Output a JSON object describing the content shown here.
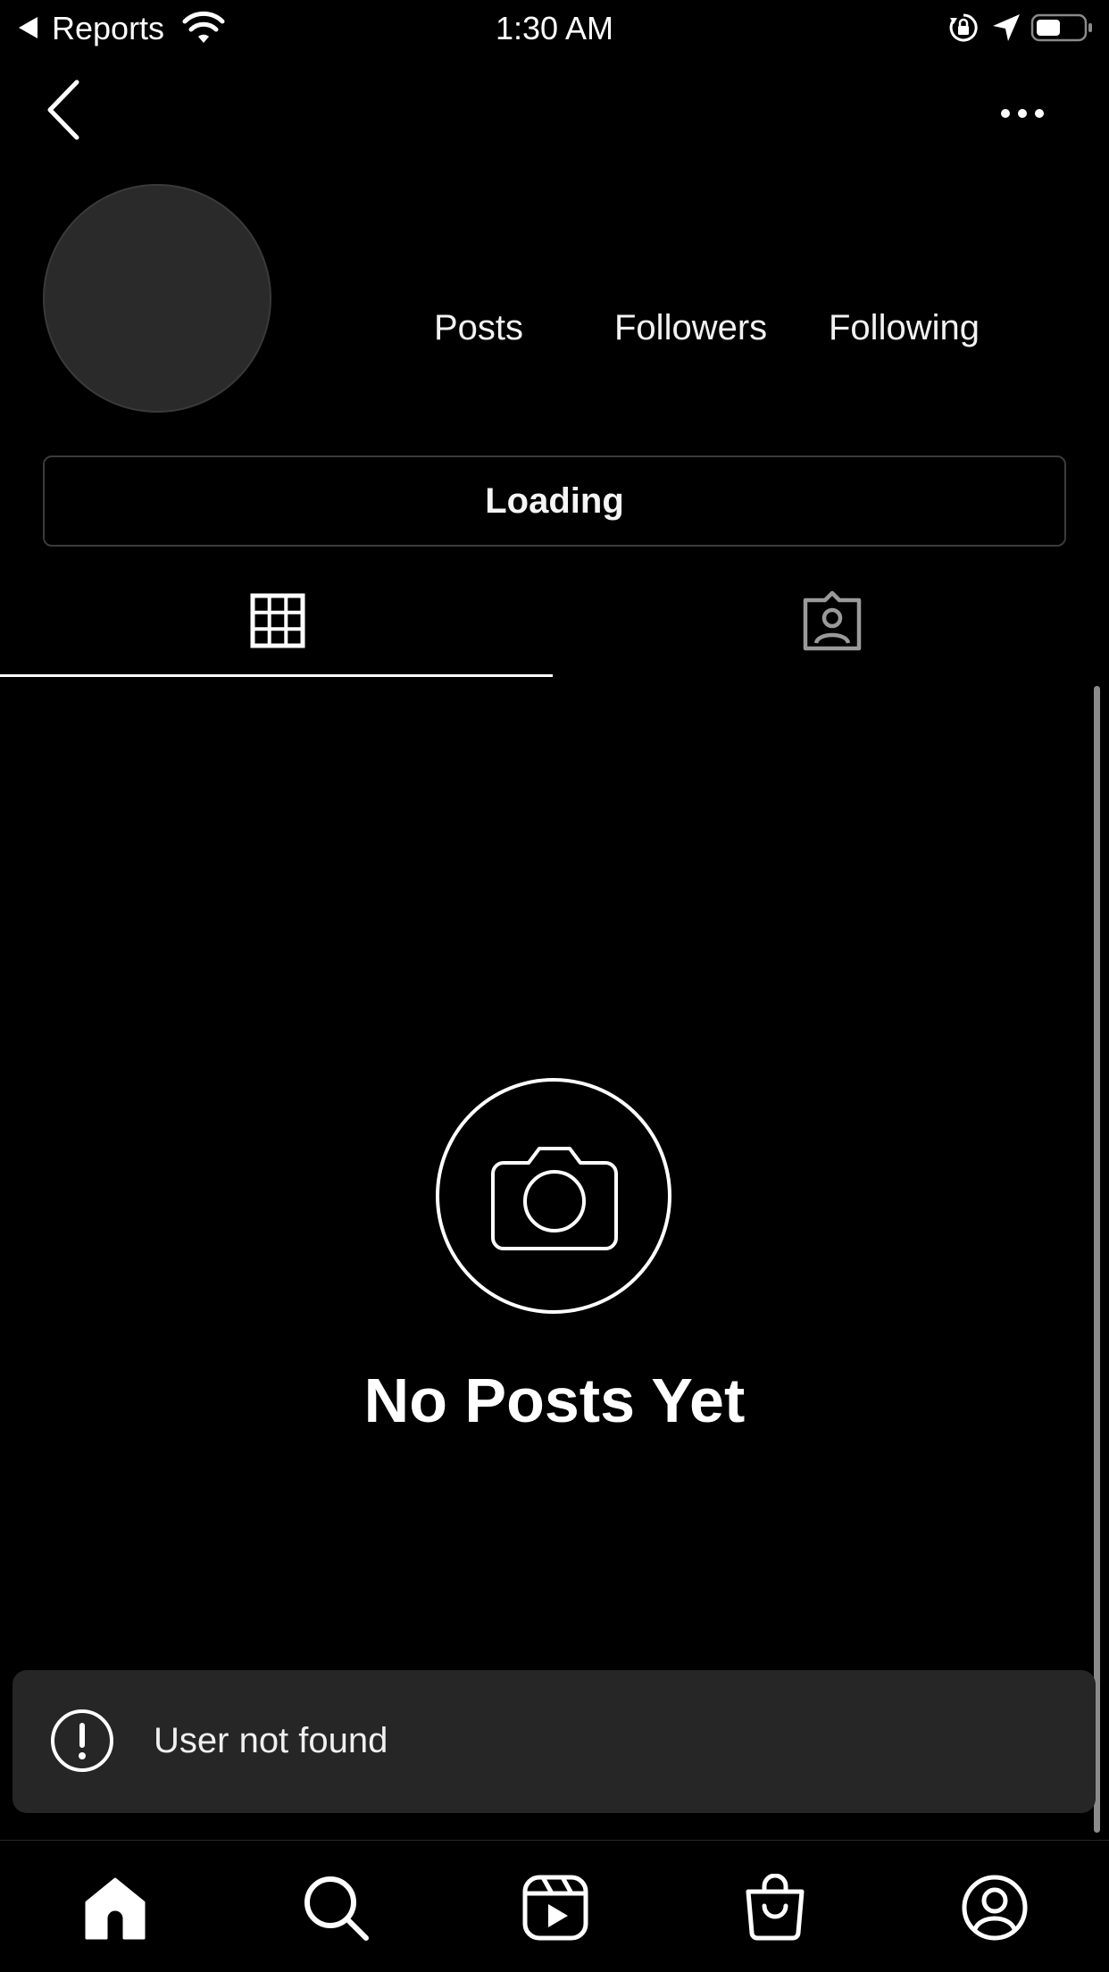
{
  "status_bar": {
    "back_app": "Reports",
    "time": "1:30 AM",
    "icons": [
      "back-arrow-icon",
      "wifi-icon",
      "orientation-lock-icon",
      "location-arrow-icon",
      "battery-icon"
    ]
  },
  "nav": {
    "back_icon": "chevron-left-icon",
    "more_icon": "ellipsis-icon"
  },
  "profile": {
    "stats": {
      "posts_label": "Posts",
      "followers_label": "Followers",
      "following_label": "Following"
    },
    "action_button_label": "Loading"
  },
  "tabs": [
    {
      "name": "grid",
      "icon": "grid-icon",
      "active": true
    },
    {
      "name": "tagged",
      "icon": "tagged-person-icon",
      "active": false
    }
  ],
  "empty_state": {
    "icon": "camera-icon",
    "title": "No Posts Yet"
  },
  "toast": {
    "icon": "exclamation-circle-icon",
    "message": "User not found"
  },
  "bottom_nav": [
    {
      "name": "home",
      "icon": "home-icon",
      "active": true
    },
    {
      "name": "search",
      "icon": "search-icon"
    },
    {
      "name": "reels",
      "icon": "reels-icon"
    },
    {
      "name": "shop",
      "icon": "shopping-bag-icon"
    },
    {
      "name": "profile",
      "icon": "profile-icon"
    }
  ],
  "colors": {
    "background": "#000000",
    "toast_background": "#262626",
    "avatar_fill": "#2a2a2a",
    "text": "#ffffff"
  }
}
